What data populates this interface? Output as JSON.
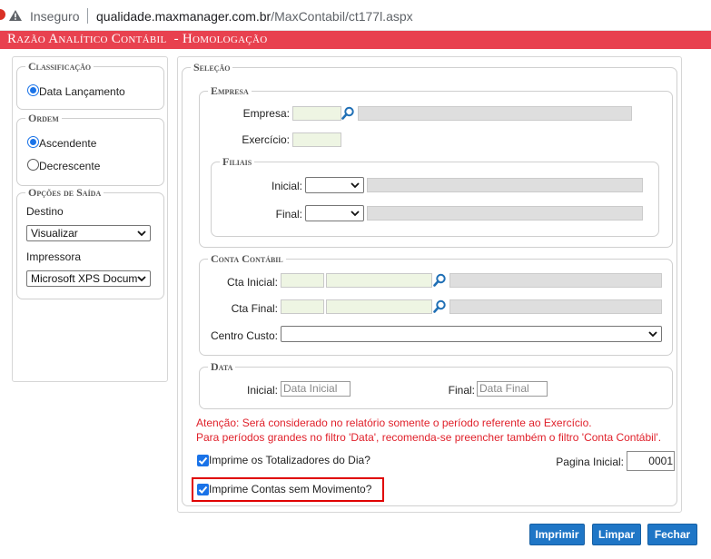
{
  "browser": {
    "security_label": "Inseguro",
    "url_host": "qualidade.maxmanager.com.br",
    "url_path": "/MaxContabil/ct177l.aspx"
  },
  "header": {
    "title": "Razão Analítico Contábil  - Homologação",
    "color": "#e8414f"
  },
  "left": {
    "classificacao": {
      "legend": "Classificação",
      "options": [
        {
          "label": "Data Lançamento",
          "selected": true
        }
      ]
    },
    "ordem": {
      "legend": "Ordem",
      "options": [
        {
          "label": "Ascendente",
          "selected": true
        },
        {
          "label": "Decrescente",
          "selected": false
        }
      ]
    },
    "saida": {
      "legend": "Opções de Saída",
      "destino_label": "Destino",
      "destino_value": "Visualizar",
      "impressora_label": "Impressora",
      "impressora_value": "Microsoft XPS Docum"
    }
  },
  "selecao": {
    "legend": "Seleção",
    "empresa": {
      "legend": "Empresa",
      "empresa_label": "Empresa:",
      "exercicio_label": "Exercício:",
      "filiais": {
        "legend": "Filiais",
        "inicial_label": "Inicial:",
        "final_label": "Final:"
      }
    },
    "conta": {
      "legend": "Conta Contábil",
      "cta_inicial_label": "Cta Inicial:",
      "cta_final_label": "Cta Final:",
      "centro_custo_label": "Centro Custo:"
    },
    "data": {
      "legend": "Data",
      "inicial_label": "Inicial:",
      "inicial_placeholder": "Data Inicial",
      "final_label": "Final:",
      "final_placeholder": "Data Final"
    },
    "warning_line1": "Atenção: Será considerado no relatório somente o período referente ao Exercício.",
    "warning_line2": "Para períodos grandes no filtro 'Data', recomenda-se preencher também o filtro 'Conta Contábil'.",
    "totalizadores_label": "Imprime os Totalizadores do Dia?",
    "totalizadores_checked": true,
    "pagina_label": "Pagina Inicial:",
    "pagina_value": "0001",
    "contas_sem_mov_label": "Imprime Contas sem Movimento?",
    "contas_sem_mov_checked": true
  },
  "actions": {
    "imprimir": "Imprimir",
    "limpar": "Limpar",
    "fechar": "Fechar"
  }
}
